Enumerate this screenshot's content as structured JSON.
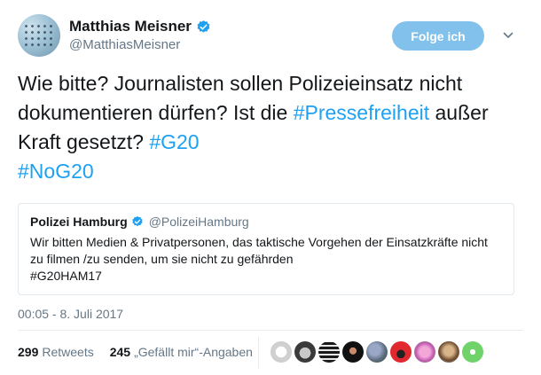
{
  "author": {
    "name": "Matthias Meisner",
    "handle": "@MatthiasMeisner",
    "avatar_icon": "user-avatar-icon"
  },
  "follow_button_label": "Folge ich",
  "tweet": {
    "text_part1": "Wie bitte? Journalisten sollen Polizeieinsatz nicht dokumentieren dürfen? Ist die ",
    "hashtag1": "#Pressefreiheit",
    "text_part2": " außer Kraft gesetzt? ",
    "hashtag2": "#G20",
    "hashtag3": "#NoG20"
  },
  "quote": {
    "name": "Polizei Hamburg",
    "handle": "@PolizeiHamburg",
    "body_line1": "Wir bitten Medien & Privatpersonen, das taktische Vorgehen der Einsatzkräfte nicht",
    "body_line2": "zu filmen /zu senden, um sie nicht zu gefährden",
    "body_line3": "#G20HAM17"
  },
  "timestamp": "00:05 - 8. Juli 2017",
  "stats": {
    "retweets_count": "299",
    "retweets_label": "Retweets",
    "likes_count": "245",
    "likes_label": "„Gefällt mir“-Angaben"
  },
  "colors": {
    "link": "#1da1f2",
    "follow_button": "#82c1ec",
    "secondary_text": "#657786"
  }
}
